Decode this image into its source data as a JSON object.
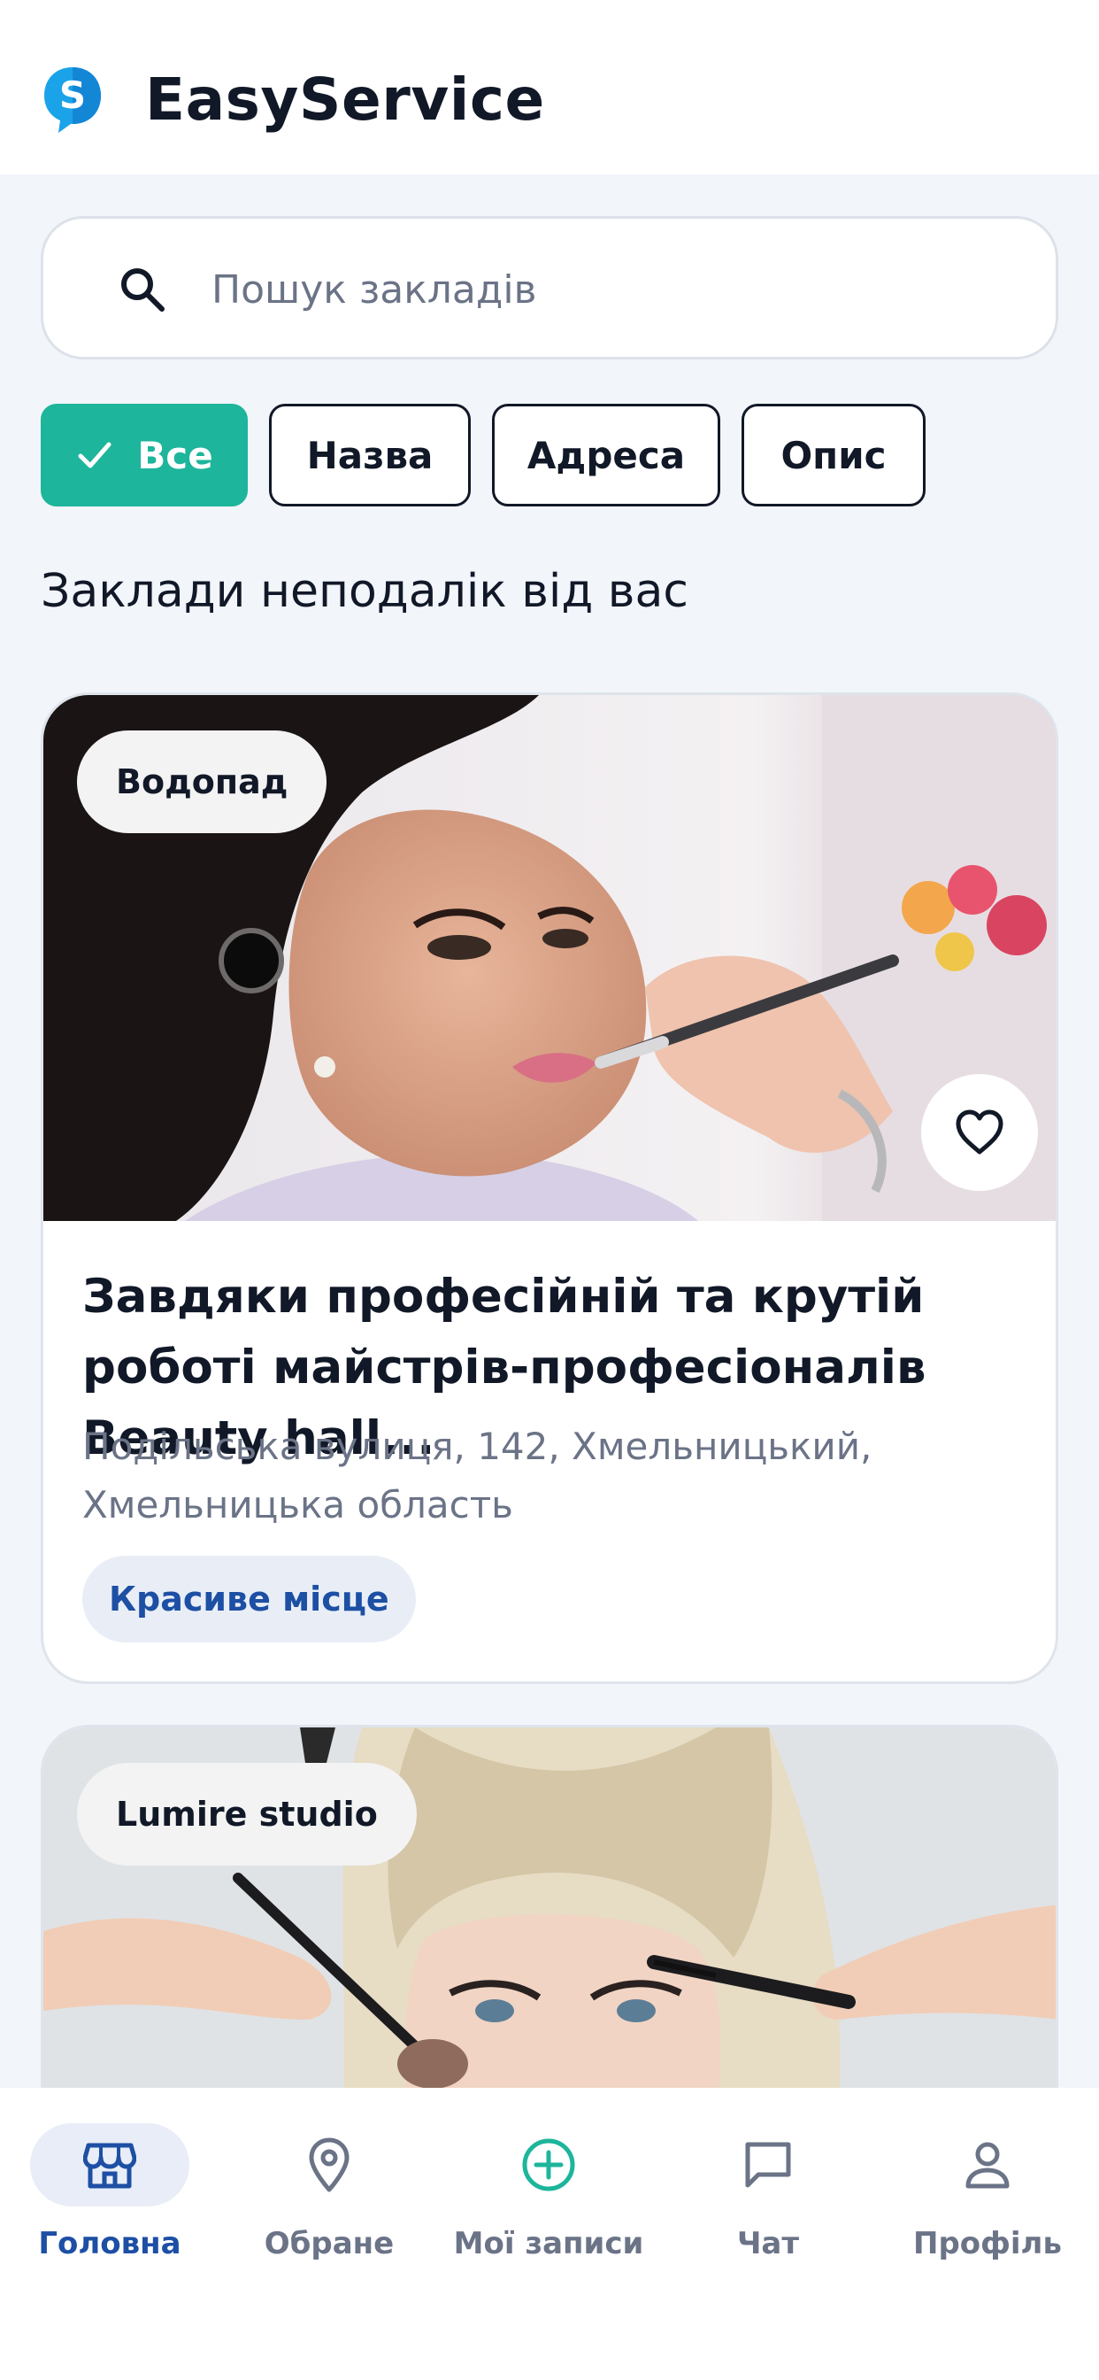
{
  "app": {
    "title": "EasyService"
  },
  "search": {
    "placeholder": "Пошук закладів",
    "value": ""
  },
  "filters": [
    {
      "label": "Все",
      "active": true
    },
    {
      "label": "Назва",
      "active": false
    },
    {
      "label": "Адреса",
      "active": false
    },
    {
      "label": "Опис",
      "active": false
    }
  ],
  "section": {
    "title": "Заклади неподалік від вас"
  },
  "cards": [
    {
      "name": "Водопад",
      "title": "Завдяки професійній та крутій роботі майстрів-професіоналів Beauty hall...",
      "address": "Подільська вулиця, 142, Хмельницький, Хмельницька область",
      "tag": "Красиве місце",
      "favorite_icon": "heart-outline-icon"
    },
    {
      "name": "Lumire studio"
    }
  ],
  "nav": [
    {
      "label": "Головна",
      "icon": "store-icon",
      "active": true
    },
    {
      "label": "Обране",
      "icon": "location-pin-icon",
      "active": false
    },
    {
      "label": "Мої записи",
      "icon": "plus-circle-icon",
      "active": false
    },
    {
      "label": "Чат",
      "icon": "chat-icon",
      "active": false
    },
    {
      "label": "Профіль",
      "icon": "user-icon",
      "active": false
    }
  ],
  "colors": {
    "accent": "#1db59b",
    "primary_blue": "#1d4fa4",
    "background": "#f2f5fa",
    "muted_text": "#6b7387"
  }
}
